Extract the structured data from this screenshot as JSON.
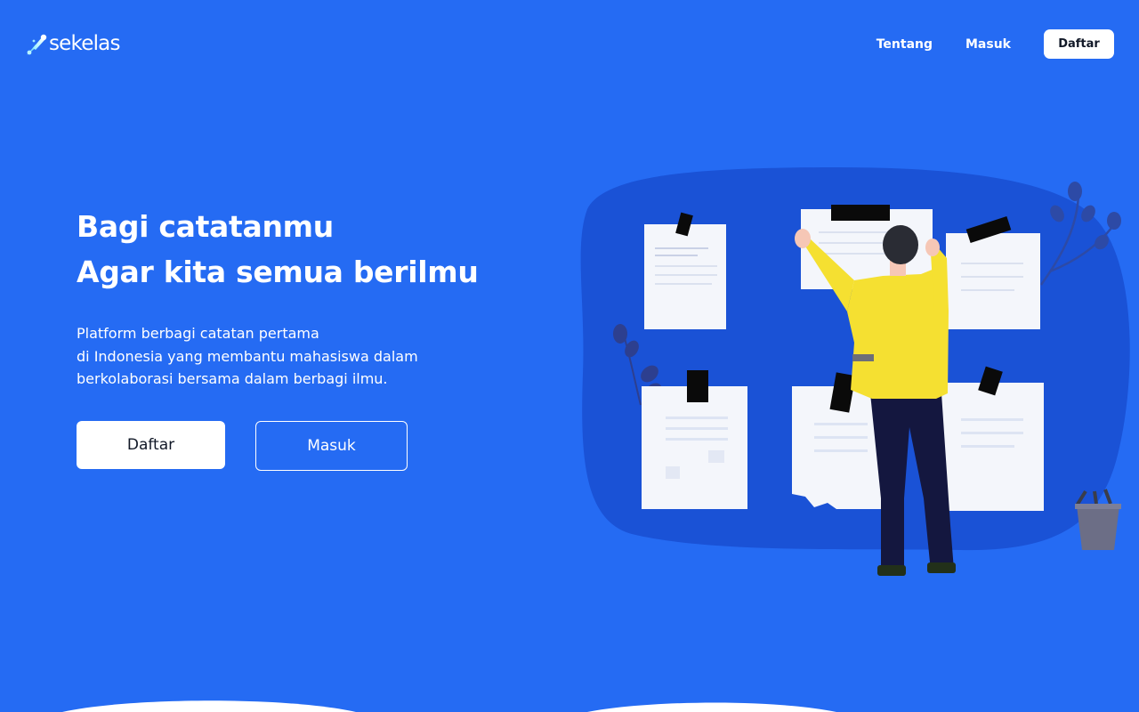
{
  "header": {
    "logo_text": "sekelas",
    "logo_icon": "rocket-icon",
    "nav": {
      "tentang": "Tentang",
      "masuk": "Masuk",
      "daftar": "Daftar"
    }
  },
  "hero": {
    "title_line1": "Bagi catatanmu",
    "title_line2": "Agar kita semua berilmu",
    "desc_line1": "Platform berbagi catatan pertama",
    "desc_line2": "di Indonesia yang membantu mahasiswa dalam",
    "desc_line3": "berkolaborasi bersama dalam berbagi ilmu.",
    "btn_daftar": "Daftar",
    "btn_masuk": "Masuk"
  },
  "colors": {
    "background": "#256bf3",
    "blob": "#1a52d6",
    "jacket": "#f5e031",
    "pants": "#14173f",
    "paper": "#f4f6fb"
  }
}
